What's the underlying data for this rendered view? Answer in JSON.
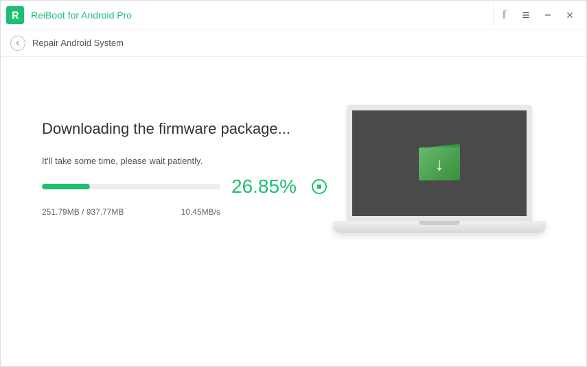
{
  "app": {
    "title": "ReiBoot for Android Pro"
  },
  "subheader": {
    "title": "Repair Android System"
  },
  "main": {
    "heading": "Downloading the firmware package...",
    "subtitle": "It'll take some time, please wait patiently.",
    "progress_percent_label": "26.85%",
    "progress_percent_value": 26.85,
    "downloaded_label": "251.79MB / 937.77MB",
    "speed_label": "10.45MB/s"
  },
  "colors": {
    "accent": "#1DBF73"
  }
}
